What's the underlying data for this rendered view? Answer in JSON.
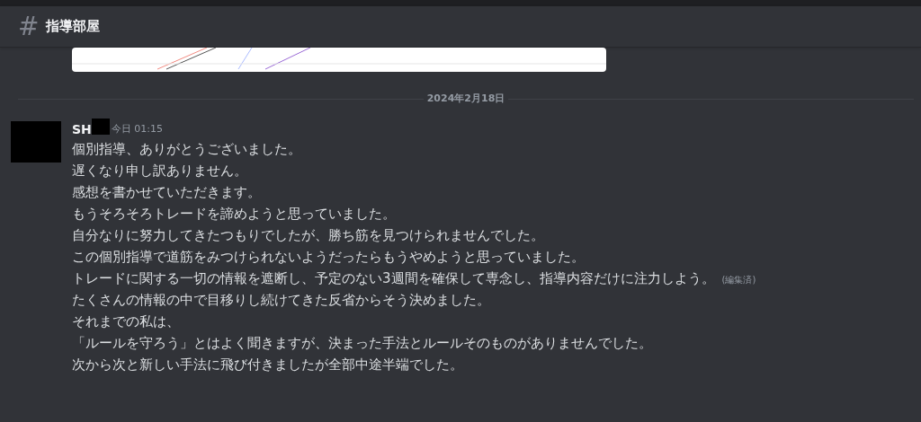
{
  "channel": {
    "icon": "#",
    "name": "指導部屋"
  },
  "date_divider": "2024年2月18日",
  "message": {
    "author": "SH",
    "timestamp": "今日 01:15",
    "lines": [
      {
        "text": "個別指導、ありがとうございました。"
      },
      {
        "text": "遅くなり申し訳ありません。"
      },
      {
        "text": "感想を書かせていただきます。"
      },
      {
        "text": "もうそろそろトレードを諦めようと思っていました。"
      },
      {
        "text": "自分なりに努力してきたつもりでしたが、勝ち筋を見つけられませんでした。"
      },
      {
        "text": "この個別指導で道筋をみつけられないようだったらもうやめようと思っていました。"
      },
      {
        "text": "トレードに関する一切の情報を遮断し、予定のない3週間を確保して専念し、指導内容だけに注力しよう。",
        "edited_label": "(編集済)"
      },
      {
        "text": "たくさんの情報の中で目移りし続けてきた反省からそう決めました。"
      },
      {
        "text": "それまでの私は、"
      },
      {
        "text": "「ルールを守ろう」とはよく聞きますが、決まった手法とルールそのものがありませんでした。"
      },
      {
        "text": "次から次と新しい手法に飛び付きましたが全部中途半端でした。"
      }
    ]
  }
}
